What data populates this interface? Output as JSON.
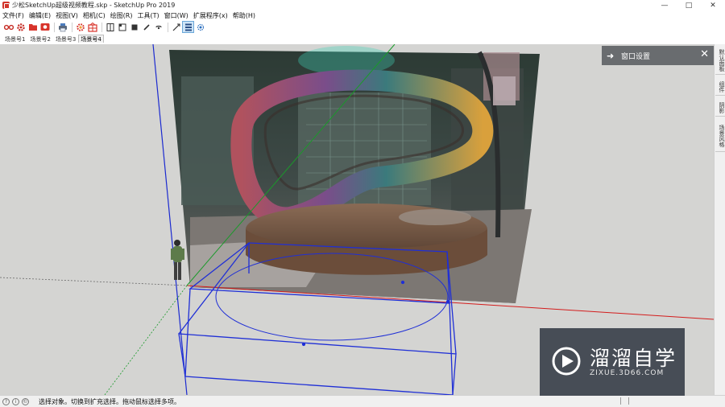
{
  "window": {
    "title": "少松SketchUp超级视频教程.skp - SketchUp Pro 2019",
    "controls": {
      "minimize": "—",
      "maximize": "□",
      "close": "✕"
    }
  },
  "menu": [
    "文件(F)",
    "编辑(E)",
    "视图(V)",
    "相机(C)",
    "绘图(R)",
    "工具(T)",
    "窗口(W)",
    "扩展程序(x)",
    "帮助(H)"
  ],
  "toolbar": {
    "icons": [
      "glasses-icon",
      "gear-red-icon",
      "folder-red-icon",
      "camera-red-icon",
      "printer-icon",
      "settings-red-icon",
      "grid-red-icon",
      "layout-split-icon",
      "face-icon",
      "box-icon",
      "pencil-icon",
      "brush-icon",
      "axes-icon",
      "list-icon",
      "sun-icon"
    ]
  },
  "scenes": {
    "tabs": [
      "场景号1",
      "场景号2",
      "场景号3",
      "场景号4"
    ],
    "selected_index": 3
  },
  "tray": {
    "tabs": [
      "默认面板",
      "组件",
      "阴影",
      "场景风格"
    ]
  },
  "panel": {
    "title": "窗口设置",
    "arrow": "➜",
    "close": "✕"
  },
  "status": {
    "icons": [
      "?",
      "i",
      "©"
    ],
    "text": "选择对象。切换到扩充选择。拖动鼠标选择多项。"
  },
  "watermark": {
    "title": "溜溜自学",
    "url": "ZIXUE.3D66.COM"
  },
  "colors": {
    "viewport": "#d4d4d2",
    "selection": "#1f2fd6",
    "axis_red": "#d31c1c",
    "axis_green": "#1a9a2a",
    "axis_blue": "#1b2ad0"
  }
}
